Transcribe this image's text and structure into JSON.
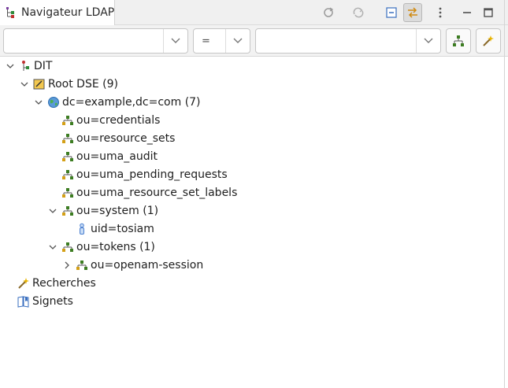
{
  "view": {
    "title": "Navigateur LDAP"
  },
  "filter": {
    "attribute": "",
    "operator": "=",
    "value": ""
  },
  "tree": {
    "dit": "DIT",
    "root_dse": "Root DSE (9)",
    "base": "dc=example,dc=com (7)",
    "credentials": "ou=credentials",
    "resource_sets": "ou=resource_sets",
    "uma_audit": "ou=uma_audit",
    "uma_pending": "ou=uma_pending_requests",
    "uma_labels": "ou=uma_resource_set_labels",
    "system": "ou=system (1)",
    "tosiam": "uid=tosiam",
    "tokens": "ou=tokens (1)",
    "openam_session": "ou=openam-session",
    "searches": "Recherches",
    "bookmarks": "Signets"
  },
  "colors": {
    "ou_icon": "#3d7d22",
    "globe": "#2f6fb0",
    "root_folder": "#e0a020",
    "user_icon": "#4a7fd0",
    "toolbar_active": "#dcdcdc"
  }
}
